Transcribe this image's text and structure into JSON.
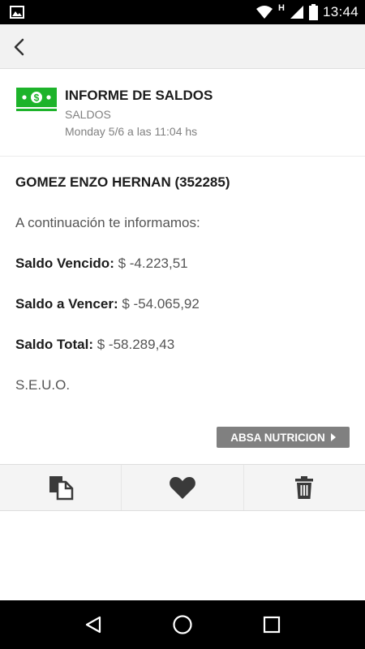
{
  "status_bar": {
    "time": "13:44",
    "network_letter": "H",
    "icons": [
      "image-icon",
      "wifi-icon",
      "signal-icon",
      "battery-icon"
    ]
  },
  "app_bar": {
    "back_icon": "back-arrow-icon"
  },
  "header": {
    "icon": "money-bill-icon",
    "title": "INFORME DE SALDOS",
    "subtitle": "SALDOS",
    "datetime": "Monday 5/6 a las 11:04 hs"
  },
  "message": {
    "client": "GOMEZ ENZO HERNAN (352285)",
    "intro": "A continuación te informamos:",
    "rows": [
      {
        "label": "Saldo Vencido:",
        "value": "$ -4.223,51"
      },
      {
        "label": "Saldo a Vencer:",
        "value": "$ -54.065,92"
      },
      {
        "label": "Saldo Total:",
        "value": "$ -58.289,43"
      }
    ],
    "footer": "S.E.U.O."
  },
  "tag_button": {
    "label": "ABSA NUTRICION"
  },
  "actions": [
    {
      "name": "copy-icon"
    },
    {
      "name": "heart-icon"
    },
    {
      "name": "trash-icon"
    }
  ],
  "colors": {
    "accent_green": "#1db32a",
    "tag_grey": "#808080",
    "text_dark": "#1c1c1c",
    "text_grey": "#808080"
  }
}
